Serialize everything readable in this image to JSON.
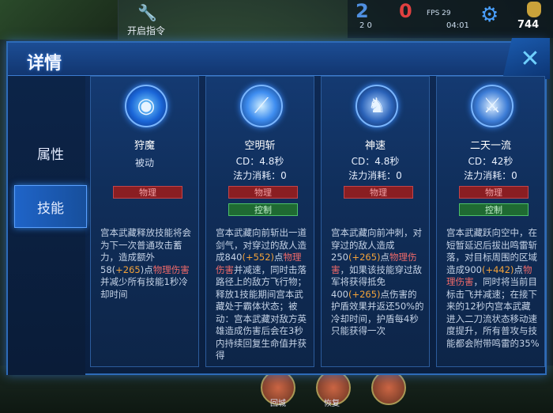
{
  "background": {
    "command_label": "开启指令",
    "score_blue": "2",
    "score_red": "0",
    "fps": "FPS 29",
    "kda": "2  0",
    "time": "04:01",
    "gold": "744",
    "bottom_left_button": "回城",
    "bottom_right_button": "恢复"
  },
  "dialog": {
    "title": "详情",
    "close_icon": "close-icon",
    "tabs": [
      {
        "label": "属性",
        "active": false
      },
      {
        "label": "技能",
        "active": true
      }
    ]
  },
  "skills": [
    {
      "name": "狩魔",
      "passive_label": "被动",
      "tag_physical": "物理",
      "desc": [
        {
          "t": "宫本武藏释放技能将会为下一次普通攻击蓄力，造成额外58("
        },
        {
          "t": "+265",
          "c": "o"
        },
        {
          "t": ")点"
        },
        {
          "t": "物理伤害",
          "c": "r"
        },
        {
          "t": "并减少所有技能1秒冷却时间"
        }
      ]
    },
    {
      "name": "空明斩",
      "cd": "CD：4.8秒",
      "cost": "法力消耗：0",
      "tag_physical": "物理",
      "tag_control": "控制",
      "desc": [
        {
          "t": "宫本武藏向前斩出一道剑气，对穿过的敌人造成840"
        },
        {
          "t": "(+552)",
          "c": "o"
        },
        {
          "t": "点"
        },
        {
          "t": "物理伤害",
          "c": "r"
        },
        {
          "t": "并减速，同时击落路径上的敌方飞行物；释放1技能期间宫本武藏处于霸体状态；被动：宫本武藏对敌方英雄造成伤害后会在3秒内持续回复生命值并获得"
        }
      ]
    },
    {
      "name": "神速",
      "cd": "CD：4.8秒",
      "cost": "法力消耗：0",
      "tag_physical": "物理",
      "desc": [
        {
          "t": "宫本武藏向前冲刺，对穿过的敌人造成250"
        },
        {
          "t": "(+265)",
          "c": "o"
        },
        {
          "t": "点"
        },
        {
          "t": "物理伤害",
          "c": "r"
        },
        {
          "t": "，如果该技能穿过敌军将获得抵免400"
        },
        {
          "t": "(+265)",
          "c": "o"
        },
        {
          "t": "点伤害的护盾效果并返还50%的冷却时间，护盾每4秒只能获得一次"
        }
      ]
    },
    {
      "name": "二天一流",
      "cd": "CD：42秒",
      "cost": "法力消耗：0",
      "tag_physical": "物理",
      "tag_control": "控制",
      "desc": [
        {
          "t": "宫本武藏跃向空中，在短暂延迟后拔出鸣雷斩落，对目标周围的区域造成900"
        },
        {
          "t": "(+442)",
          "c": "o"
        },
        {
          "t": "点"
        },
        {
          "t": "物理伤害",
          "c": "r"
        },
        {
          "t": "，同时将当前目标击飞并减速；在接下来的12秒内宫本武藏进入二刀流状态移动速度提升，所有普攻与技能都会附带鸣雷的35%"
        }
      ]
    }
  ]
}
